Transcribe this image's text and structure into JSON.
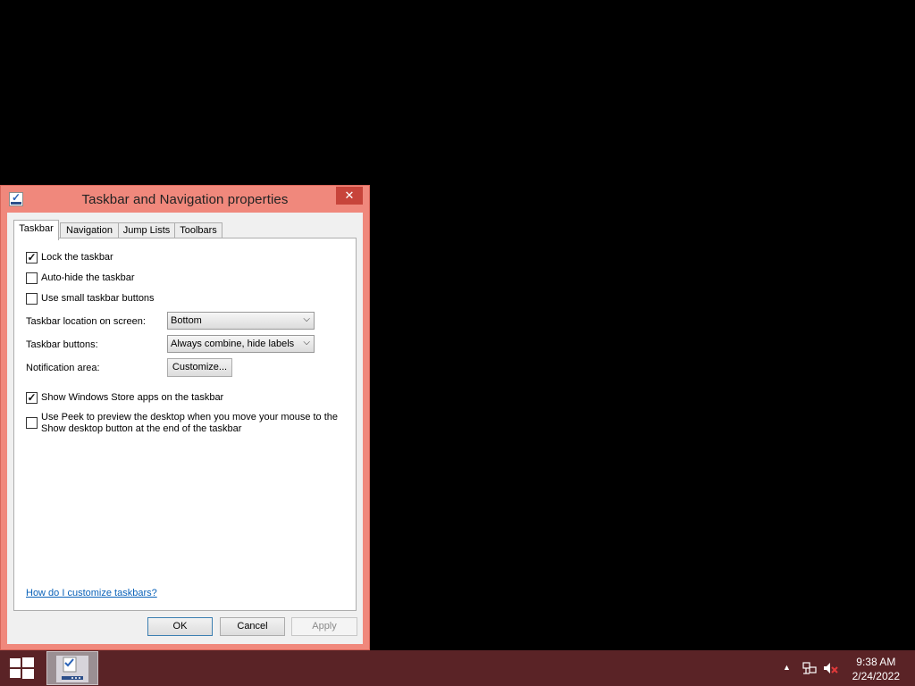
{
  "dialog": {
    "title": "Taskbar and Navigation properties",
    "close_glyph": "✕",
    "tabs": [
      {
        "label": "Taskbar",
        "active": true
      },
      {
        "label": "Navigation",
        "active": false
      },
      {
        "label": "Jump Lists",
        "active": false
      },
      {
        "label": "Toolbars",
        "active": false
      }
    ],
    "checkboxes": {
      "lock": {
        "label": "Lock the taskbar",
        "checked": true
      },
      "autohide": {
        "label": "Auto-hide the taskbar",
        "checked": false
      },
      "small_buttons": {
        "label": "Use small taskbar buttons",
        "checked": false
      },
      "store_apps": {
        "label": "Show Windows Store apps on the taskbar",
        "checked": true
      },
      "peek": {
        "label": "Use Peek to preview the desktop when you move your mouse to the Show desktop button at the end of the taskbar",
        "checked": false
      }
    },
    "location": {
      "label": "Taskbar location on screen:",
      "value": "Bottom"
    },
    "buttons_setting": {
      "label": "Taskbar buttons:",
      "value": "Always combine, hide labels"
    },
    "notification": {
      "label": "Notification area:",
      "button": "Customize..."
    },
    "help_link": "How do I customize taskbars?",
    "footer": {
      "ok": "OK",
      "cancel": "Cancel",
      "apply": "Apply",
      "apply_enabled": false
    }
  },
  "taskbar": {
    "time": "9:38 AM",
    "date": "2/24/2022",
    "tray_icons": [
      "show-hidden-icons-arrow",
      "network-icon",
      "volume-muted-icon"
    ],
    "colors": {
      "taskbar": "#5a2326",
      "window_frame": "#f0887c"
    }
  }
}
